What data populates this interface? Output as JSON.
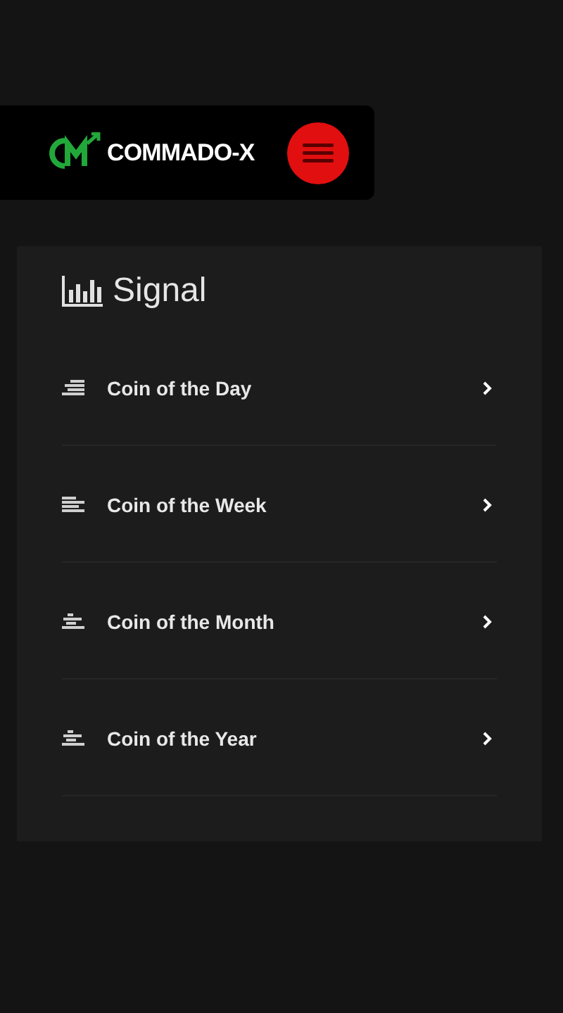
{
  "header": {
    "brand": "COMMADO-X"
  },
  "signal": {
    "title": "Signal",
    "items": [
      {
        "label": "Coin of the Day",
        "kind": "right"
      },
      {
        "label": "Coin of the Week",
        "kind": "left"
      },
      {
        "label": "Coin of the Month",
        "kind": "center"
      },
      {
        "label": "Coin of the Year",
        "kind": "center"
      }
    ]
  }
}
